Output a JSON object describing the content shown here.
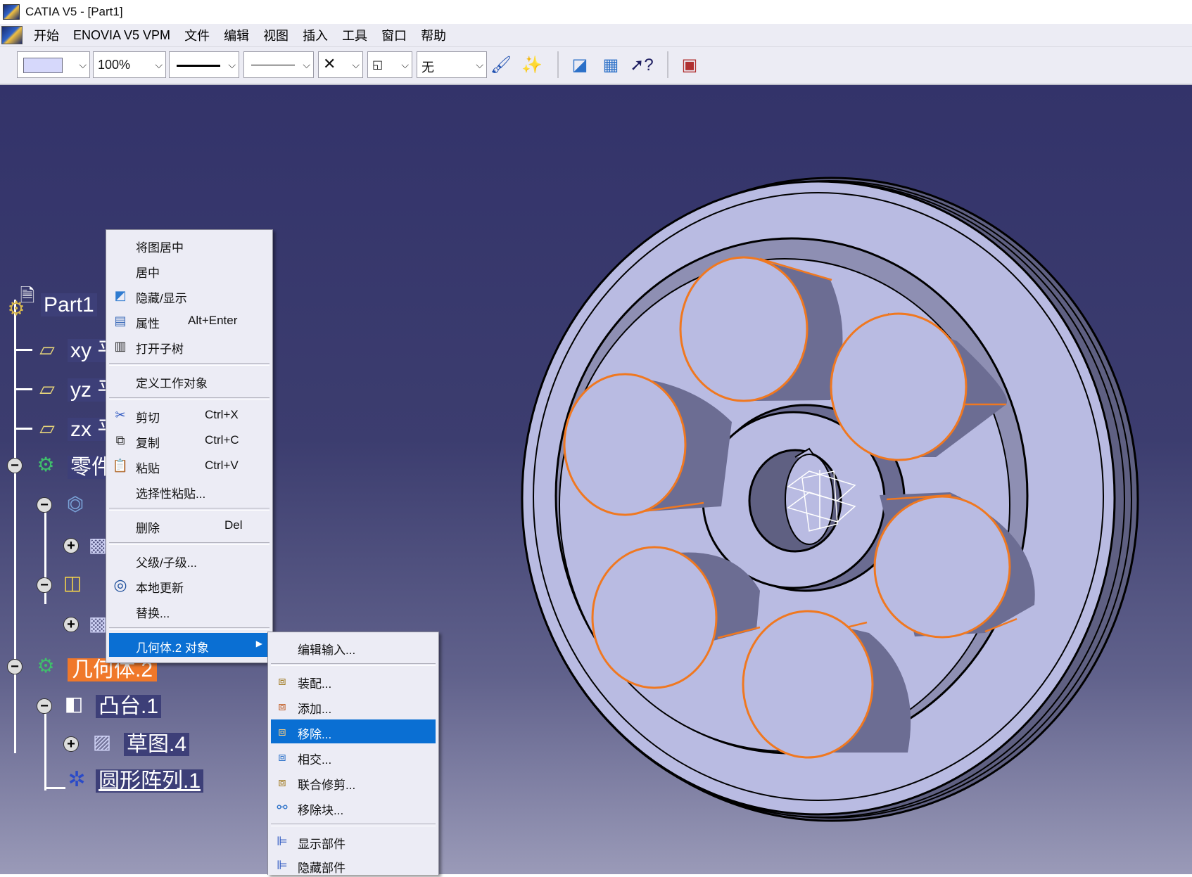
{
  "window": {
    "title": "CATIA V5 - [Part1]"
  },
  "menubar": {
    "items": [
      "开始",
      "ENOVIA V5 VPM",
      "文件",
      "编辑",
      "视图",
      "插入",
      "工具",
      "窗口",
      "帮助"
    ]
  },
  "toolbar": {
    "zoom_value": "100%",
    "layer_value": "无",
    "color_swatch": "#d6d8fb"
  },
  "tree": {
    "root": "Part1",
    "planes": [
      "xy 平",
      "yz 平",
      "zx 平"
    ],
    "partbody_truncated": "零件",
    "body2": "几何体.2",
    "pad": "凸台.1",
    "sketch": "草图.4",
    "pattern": "圆形阵列.1"
  },
  "context_menu": {
    "items": [
      {
        "label": "将图居中",
        "icon": ""
      },
      {
        "label": "居中",
        "icon": ""
      },
      {
        "label": "隐藏/显示",
        "icon": "hide-show-icon"
      },
      {
        "label": "属性",
        "shortcut": "Alt+Enter",
        "icon": "properties-icon"
      },
      {
        "label": "打开子树",
        "icon": "open-subtree-icon"
      },
      {
        "label": "定义工作对象",
        "icon": ""
      },
      {
        "label": "剪切",
        "shortcut": "Ctrl+X",
        "icon": "scissors-icon"
      },
      {
        "label": "复制",
        "shortcut": "Ctrl+C",
        "icon": "copy-icon"
      },
      {
        "label": "粘贴",
        "shortcut": "Ctrl+V",
        "icon": "paste-icon"
      },
      {
        "label": "选择性粘贴...",
        "icon": ""
      },
      {
        "label": "删除",
        "shortcut": "Del",
        "icon": ""
      },
      {
        "label": "父级/子级...",
        "icon": ""
      },
      {
        "label": "本地更新",
        "icon": "local-update-icon"
      },
      {
        "label": "替换...",
        "icon": ""
      },
      {
        "label": "几何体.2 对象",
        "icon": "",
        "highlighted": true
      }
    ]
  },
  "submenu": {
    "items": [
      {
        "label": "编辑输入...",
        "icon": ""
      },
      {
        "label": "装配...",
        "icon": "assemble-icon"
      },
      {
        "label": "添加...",
        "icon": "add-icon"
      },
      {
        "label": "移除...",
        "icon": "remove-icon",
        "highlighted": true
      },
      {
        "label": "相交...",
        "icon": "intersect-icon"
      },
      {
        "label": "联合修剪...",
        "icon": "union-trim-icon"
      },
      {
        "label": "移除块...",
        "icon": "remove-lump-icon"
      },
      {
        "label": "显示部件",
        "icon": "show-components-icon"
      },
      {
        "label": "隐藏部件",
        "icon": "hide-components-icon"
      }
    ]
  },
  "colors": {
    "viewport_top": "#33336a",
    "highlight_edge": "#f07820",
    "menu_highlight": "#0a6fd3",
    "tree_selected": "#f0782a"
  }
}
